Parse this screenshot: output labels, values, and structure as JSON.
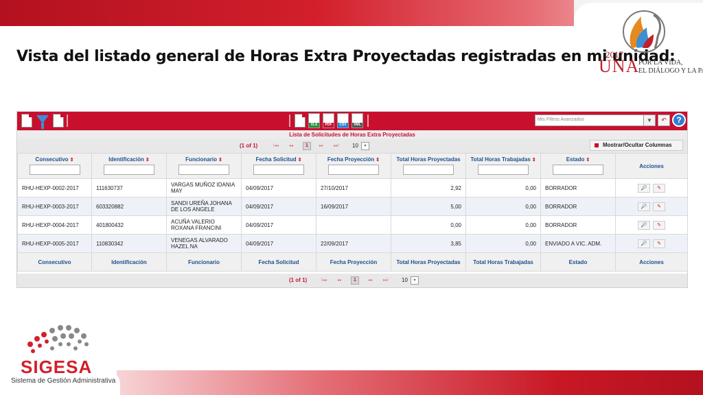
{
  "slide": {
    "title": "Vista del listado general de Horas Extra Proyectadas registradas en mi unidad:",
    "una_logo": {
      "year": "2017",
      "name": "UNA",
      "tagline_1": "POR LA VIDA,",
      "tagline_2": "EL DIÁLOGO Y LA PAZ"
    },
    "sigesa_logo": {
      "name": "SIGESA",
      "subtitle": "Sistema de Gestión Administrativa"
    }
  },
  "app": {
    "filters": {
      "placeholder": "Mis Filtros Avanzados",
      "arrow": "▼",
      "undo": "↶",
      "help": "?"
    },
    "exports": [
      "XLS",
      "PDF",
      "CSV",
      "XML"
    ],
    "caption": "Lista de Solicitudes de Horas Extra Proyectadas",
    "pager": {
      "count": "(1 of 1)",
      "first": "I◂◂",
      "prev": "◂◂",
      "page": "1",
      "next": "▸▸",
      "last": "▸▸I",
      "rows": "10",
      "rows_arrow": "▾"
    },
    "toggle_columns": "Mostrar/Ocultar Columnas",
    "sort_icon": "⇕",
    "columns": [
      "Consecutivo",
      "Identificación",
      "Funcionario",
      "Fecha Solicitud",
      "Fecha Proyección",
      "Total Horas Proyectadas",
      "Total Horas Trabajadas",
      "Estado",
      "Acciones"
    ],
    "footer_columns": [
      "Consecutivo",
      "Identificación",
      "Funcionario",
      "Fecha Solicitud",
      "Fecha Proyección",
      "Total Horas Proyectadas",
      "Total Horas Trabajadas",
      "Estado",
      "Acciones"
    ],
    "row_actions": {
      "view": "🔎",
      "edit": "✎"
    },
    "rows": [
      {
        "consecutivo": "RHU-HEXP-0002-2017",
        "identificacion": "111630737",
        "funcionario": "VARGAS MUÑOZ IDANIA MAY",
        "fecha_solicitud": "04/09/2017",
        "fecha_proyeccion": "27/10/2017",
        "horas_proyectadas": "2,92",
        "horas_trabajadas": "0,00",
        "estado": "BORRADOR"
      },
      {
        "consecutivo": "RHU-HEXP-0003-2017",
        "identificacion": "603320882",
        "funcionario": "SANDI UREÑA JOHANA DE LOS ANGELE",
        "fecha_solicitud": "04/09/2017",
        "fecha_proyeccion": "16/09/2017",
        "horas_proyectadas": "5,00",
        "horas_trabajadas": "0,00",
        "estado": "BORRADOR"
      },
      {
        "consecutivo": "RHU-HEXP-0004-2017",
        "identificacion": "401800432",
        "funcionario": "ACUÑA VALERIO ROXANA FRANCINI",
        "fecha_solicitud": "04/09/2017",
        "fecha_proyeccion": "",
        "horas_proyectadas": "0,00",
        "horas_trabajadas": "0,00",
        "estado": "BORRADOR"
      },
      {
        "consecutivo": "RHU-HEXP-0005-2017",
        "identificacion": "110830342",
        "funcionario": "VENEGAS ALVARADO HAZEL NA",
        "fecha_solicitud": "04/09/2017",
        "fecha_proyeccion": "22/09/2017",
        "horas_proyectadas": "3,85",
        "horas_trabajadas": "0,00",
        "estado": "ENVIADO A VIC. ADM."
      }
    ],
    "colors": {
      "toolbar": "#c8102e",
      "header_text": "#1c4f8c",
      "accent": "#c8102e"
    }
  }
}
